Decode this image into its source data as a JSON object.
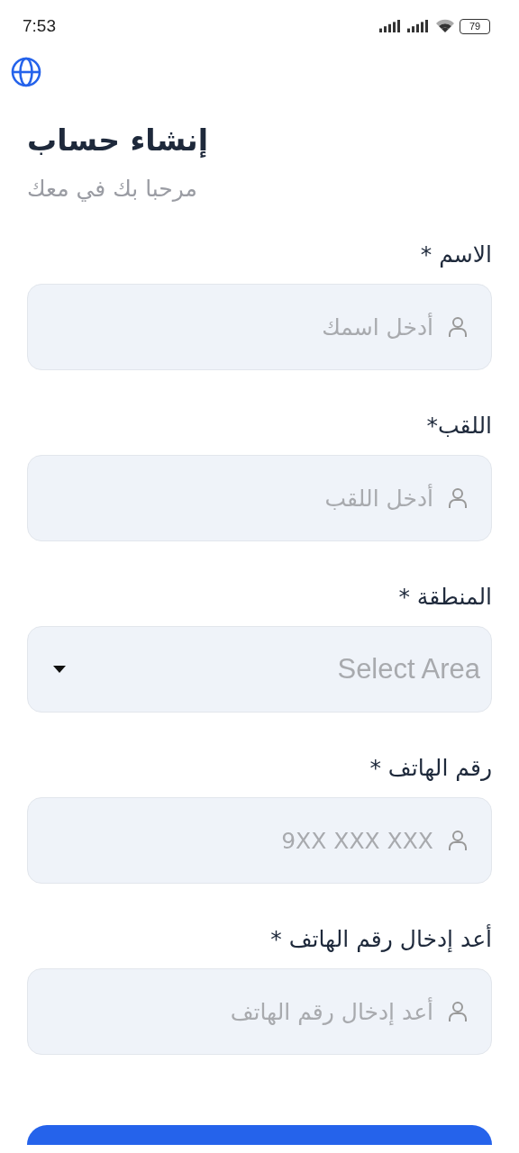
{
  "status_bar": {
    "time": "7:53",
    "battery": "79"
  },
  "title": "إنشاء حساب",
  "subtitle": "مرحبا بك في معك",
  "fields": [
    {
      "kind": "text",
      "label": "الاسم *",
      "placeholder": "أدخل اسمك"
    },
    {
      "kind": "text",
      "label": "اللقب*",
      "placeholder": "أدخل اللقب"
    },
    {
      "kind": "select",
      "label": "المنطقة *",
      "placeholder": "Select Area"
    },
    {
      "kind": "text",
      "label": "رقم الهاتف *",
      "placeholder": "9XX XXX XXX"
    },
    {
      "kind": "text",
      "label": "أعد إدخال رقم الهاتف *",
      "placeholder": "أعد إدخال رقم الهاتف"
    }
  ]
}
